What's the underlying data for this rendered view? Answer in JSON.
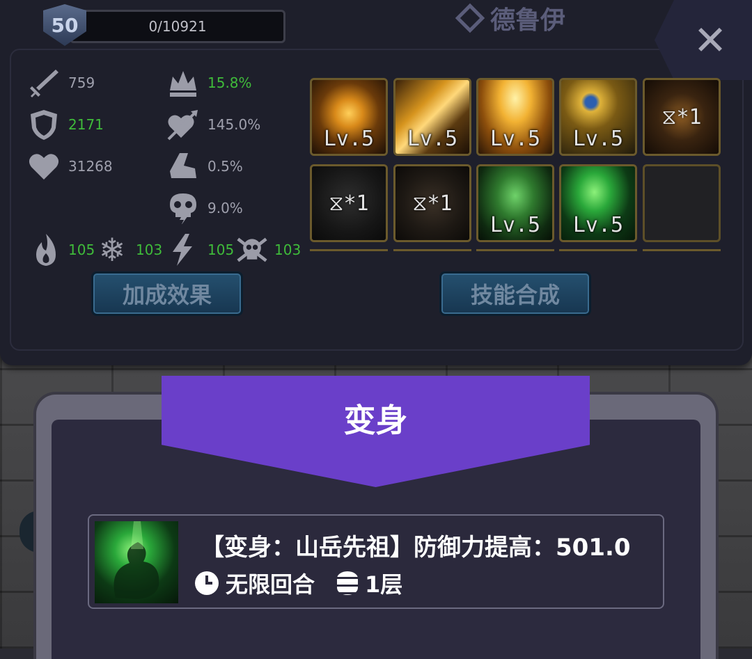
{
  "header": {
    "level": "50",
    "xp_text": "0/10921",
    "class_name": "德鲁伊",
    "close_label": "✕"
  },
  "stats_left": [
    {
      "icon": "sword-icon",
      "value": "759",
      "highlight": false
    },
    {
      "icon": "shield-icon",
      "value": "2171",
      "highlight": true
    },
    {
      "icon": "heart-icon",
      "value": "31268",
      "highlight": false
    }
  ],
  "stats_right": [
    {
      "icon": "crown-icon",
      "value": "15.8%",
      "highlight": true
    },
    {
      "icon": "heart-arrow-icon",
      "value": "145.0%",
      "highlight": false
    },
    {
      "icon": "boot-icon",
      "value": "0.5%",
      "highlight": false
    },
    {
      "icon": "skull-bolt-icon",
      "value": "9.0%",
      "highlight": false
    }
  ],
  "elements": [
    {
      "icon": "fire-icon",
      "value": "105"
    },
    {
      "icon": "snowflake-icon",
      "value": "103"
    },
    {
      "icon": "lightning-icon",
      "value": "105"
    },
    {
      "icon": "poison-skull-icon",
      "value": "103"
    }
  ],
  "skills": [
    {
      "label": "Lv.5",
      "kind": "level",
      "theme": "gold-runes"
    },
    {
      "label": "Lv.5",
      "kind": "level",
      "theme": "gold-blade"
    },
    {
      "label": "Lv.5",
      "kind": "level",
      "theme": "gold-light"
    },
    {
      "label": "Lv.5",
      "kind": "level",
      "theme": "gold-gem"
    },
    {
      "label": "⧖*1",
      "kind": "count",
      "theme": "dark-sigil"
    },
    {
      "label": "⧖*1",
      "kind": "count",
      "theme": "dark-shadow"
    },
    {
      "label": "⧖*1",
      "kind": "count",
      "theme": "dark-orb"
    },
    {
      "label": "Lv.5",
      "kind": "level",
      "theme": "green-figure"
    },
    {
      "label": "Lv.5",
      "kind": "level",
      "theme": "green-beast"
    },
    {
      "label": "",
      "kind": "empty",
      "theme": "empty"
    }
  ],
  "buttons": {
    "bonus_effects": "加成效果",
    "skill_synthesis": "技能合成"
  },
  "popup": {
    "title": "变身",
    "buff_description": "【变身：山岳先祖】防御力提高：501.0",
    "duration": "无限回合",
    "stacks": "1层"
  },
  "colors": {
    "accent_purple": "#6a3fc9",
    "stat_green": "#3fbb3a",
    "frame_gold": "#6b5a2c"
  }
}
